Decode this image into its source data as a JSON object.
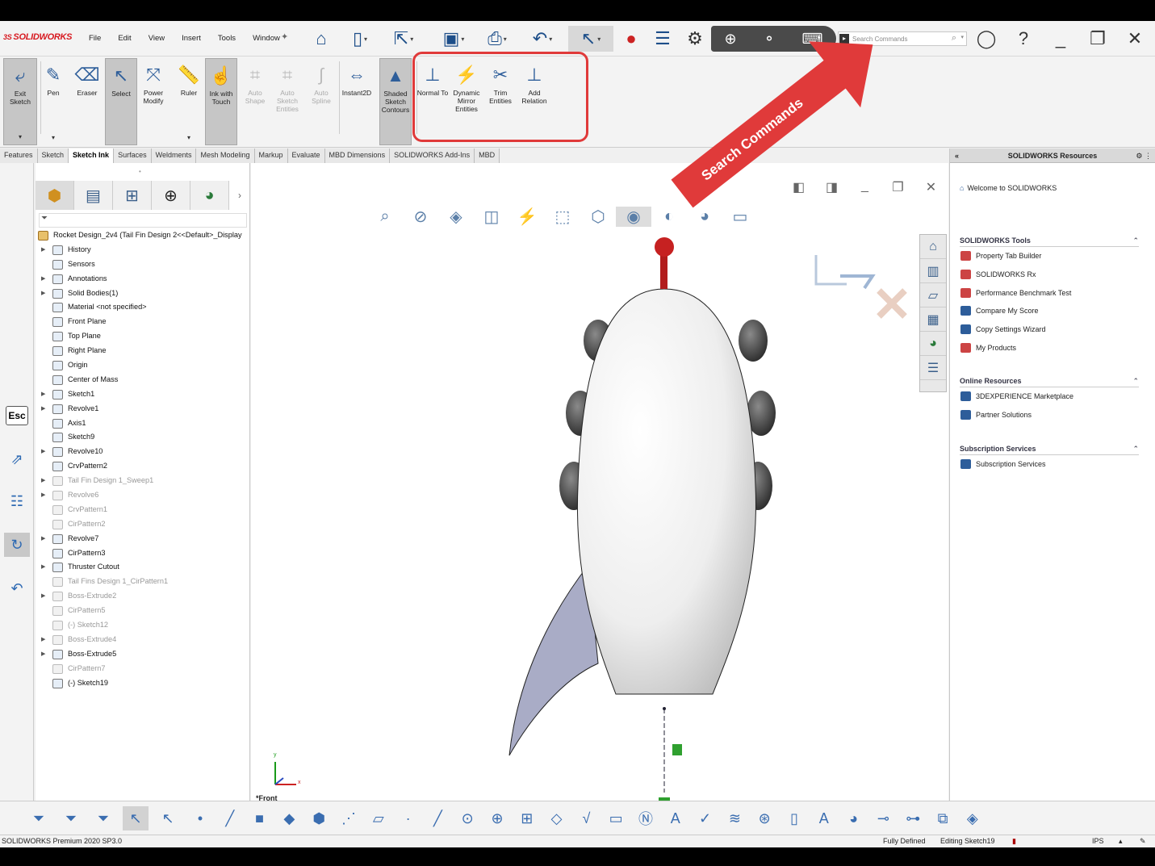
{
  "app": {
    "brand": "SOLIDWORKS",
    "brand_prefix": "3S",
    "menu": [
      "File",
      "Edit",
      "View",
      "Insert",
      "Tools",
      "Window"
    ],
    "search_placeholder": "Search Commands"
  },
  "ribbon": {
    "buttons": [
      {
        "label": "Exit Sketch",
        "icon": "exit-sketch-icon",
        "state": "pressed"
      },
      {
        "label": "Pen",
        "icon": "pen-icon",
        "state": "normal"
      },
      {
        "label": "Eraser",
        "icon": "eraser-icon",
        "state": "normal"
      },
      {
        "label": "Select",
        "icon": "cursor-icon",
        "state": "pressed"
      },
      {
        "label": "Power Modify",
        "icon": "power-modify-icon",
        "state": "normal"
      },
      {
        "label": "Ruler",
        "icon": "ruler-icon",
        "state": "normal"
      },
      {
        "label": "Ink with Touch",
        "icon": "touch-icon",
        "state": "pressed"
      },
      {
        "label": "Auto Shape",
        "icon": "auto-shape-icon",
        "state": "disabled"
      },
      {
        "label": "Auto Sketch Entities",
        "icon": "auto-sketch-icon",
        "state": "disabled"
      },
      {
        "label": "Auto Spline",
        "icon": "auto-spline-icon",
        "state": "disabled"
      },
      {
        "label": "Instant2D",
        "icon": "instant2d-icon",
        "state": "normal"
      },
      {
        "label": "Shaded Sketch Contours",
        "icon": "shaded-contour-icon",
        "state": "pressed"
      },
      {
        "label": "Normal To",
        "icon": "normal-to-icon",
        "state": "normal"
      },
      {
        "label": "Dynamic Mirror Entities",
        "icon": "mirror-icon",
        "state": "normal"
      },
      {
        "label": "Trim Entities",
        "icon": "trim-icon",
        "state": "normal"
      },
      {
        "label": "Add Relation",
        "icon": "relation-icon",
        "state": "normal"
      }
    ]
  },
  "tabs": [
    "Features",
    "Sketch",
    "Sketch Ink",
    "Surfaces",
    "Weldments",
    "Mesh Modeling",
    "Markup",
    "Evaluate",
    "MBD Dimensions",
    "SOLIDWORKS Add-Ins",
    "MBD"
  ],
  "active_tab": "Sketch Ink",
  "left_tools": {
    "esc": "Esc"
  },
  "feature_tree": {
    "root": "Rocket Design_2v4  (Tail Fin Design 2<<Default>_Display",
    "nodes": [
      {
        "label": "History",
        "expandable": true,
        "suppressed": false
      },
      {
        "label": "Sensors",
        "expandable": false,
        "suppressed": false
      },
      {
        "label": "Annotations",
        "expandable": true,
        "suppressed": false
      },
      {
        "label": "Solid Bodies(1)",
        "expandable": true,
        "suppressed": false
      },
      {
        "label": "Material <not specified>",
        "expandable": false,
        "suppressed": false
      },
      {
        "label": "Front Plane",
        "expandable": false,
        "suppressed": false
      },
      {
        "label": "Top Plane",
        "expandable": false,
        "suppressed": false
      },
      {
        "label": "Right Plane",
        "expandable": false,
        "suppressed": false
      },
      {
        "label": "Origin",
        "expandable": false,
        "suppressed": false
      },
      {
        "label": "Center of Mass",
        "expandable": false,
        "suppressed": false
      },
      {
        "label": "Sketch1",
        "expandable": true,
        "suppressed": false
      },
      {
        "label": "Revolve1",
        "expandable": true,
        "suppressed": false
      },
      {
        "label": "Axis1",
        "expandable": false,
        "suppressed": false
      },
      {
        "label": "Sketch9",
        "expandable": false,
        "suppressed": false
      },
      {
        "label": "Revolve10",
        "expandable": true,
        "suppressed": false
      },
      {
        "label": "CrvPattern2",
        "expandable": false,
        "suppressed": false
      },
      {
        "label": "Tail Fin Design 1_Sweep1",
        "expandable": true,
        "suppressed": true
      },
      {
        "label": "Revolve6",
        "expandable": true,
        "suppressed": true
      },
      {
        "label": "CrvPattern1",
        "expandable": false,
        "suppressed": true
      },
      {
        "label": "CirPattern2",
        "expandable": false,
        "suppressed": true
      },
      {
        "label": "Revolve7",
        "expandable": true,
        "suppressed": false
      },
      {
        "label": "CirPattern3",
        "expandable": false,
        "suppressed": false
      },
      {
        "label": "Thruster Cutout",
        "expandable": true,
        "suppressed": false
      },
      {
        "label": "Tail Fins Design 1_CirPattern1",
        "expandable": false,
        "suppressed": true
      },
      {
        "label": "Boss-Extrude2",
        "expandable": true,
        "suppressed": true
      },
      {
        "label": "CirPattern5",
        "expandable": false,
        "suppressed": true
      },
      {
        "label": "(-) Sketch12",
        "expandable": false,
        "suppressed": true
      },
      {
        "label": "Boss-Extrude4",
        "expandable": true,
        "suppressed": true
      },
      {
        "label": "Boss-Extrude5",
        "expandable": true,
        "suppressed": false
      },
      {
        "label": "CirPattern7",
        "expandable": false,
        "suppressed": true
      },
      {
        "label": "(-) Sketch19",
        "expandable": false,
        "suppressed": false
      }
    ]
  },
  "viewport": {
    "view_label": "*Front",
    "axis_x": "x",
    "axis_y": "y"
  },
  "annotation": {
    "text": "Search Commands",
    "color": "#e03a3a"
  },
  "resources": {
    "title": "SOLIDWORKS Resources",
    "welcome": "Welcome to SOLIDWORKS",
    "sections": [
      {
        "title": "SOLIDWORKS Tools",
        "items": [
          "Property Tab Builder",
          "SOLIDWORKS Rx",
          "Performance Benchmark Test",
          "Compare My Score",
          "Copy Settings Wizard",
          "My Products"
        ]
      },
      {
        "title": "Online Resources",
        "items": [
          "3DEXPERIENCE Marketplace",
          "Partner Solutions"
        ]
      },
      {
        "title": "Subscription Services",
        "items": [
          "Subscription Services"
        ]
      }
    ]
  },
  "status": {
    "product": "SOLIDWORKS Premium 2020 SP3.0",
    "defined": "Fully Defined",
    "editing": "Editing Sketch19",
    "units": "IPS"
  }
}
